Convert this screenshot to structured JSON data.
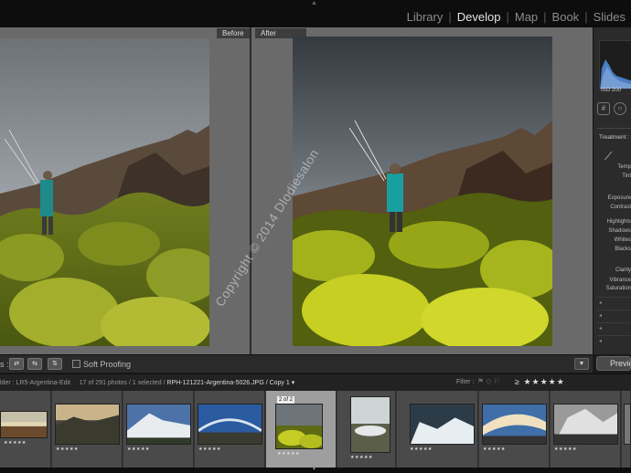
{
  "modules": [
    "Library",
    "Develop",
    "Map",
    "Book",
    "Slides"
  ],
  "active_module": "Develop",
  "views": {
    "before_label": "Before",
    "after_label": "After"
  },
  "watermark": "Copyright © 2014 Dlodiesalon",
  "right_panel": {
    "histogram_info": "ISO 200",
    "treatment_label": "Treatment :",
    "temp_label": "Temp",
    "tint_label": "Tint",
    "exposure_label": "Exposure",
    "contrast_label": "Contrast",
    "highlights_label": "Highlights",
    "shadows_label": "Shadows",
    "whites_label": "Whites",
    "blacks_label": "Blacks",
    "clarity_label": "Clarity",
    "vibrance_label": "Vibrance",
    "saturation_label": "Saturation",
    "previous_label": "Previous"
  },
  "toolbar": {
    "view_label": "s :",
    "soft_proofing_label": "Soft Proofing"
  },
  "filmstrip_info": {
    "folder": "lder : LR5-Argentina-Edit",
    "count": "17 of 291 photos / 1 selected /",
    "filename": "RPH-121221-Argentina-5026.JPG / Copy 1 ▾",
    "filter_label": "Filter :",
    "filter_rating": "≥ ★★★★★"
  },
  "filmstrip": {
    "stars": "★★★★★",
    "selected_badge": "2 of 2",
    "badge_2": "2"
  },
  "colors": {
    "panel_bg": "#6a6a6a",
    "module_active": "#e6e6e6",
    "module_inactive": "#8c8c8c",
    "filmstrip_selected": "#9e9e9e"
  }
}
